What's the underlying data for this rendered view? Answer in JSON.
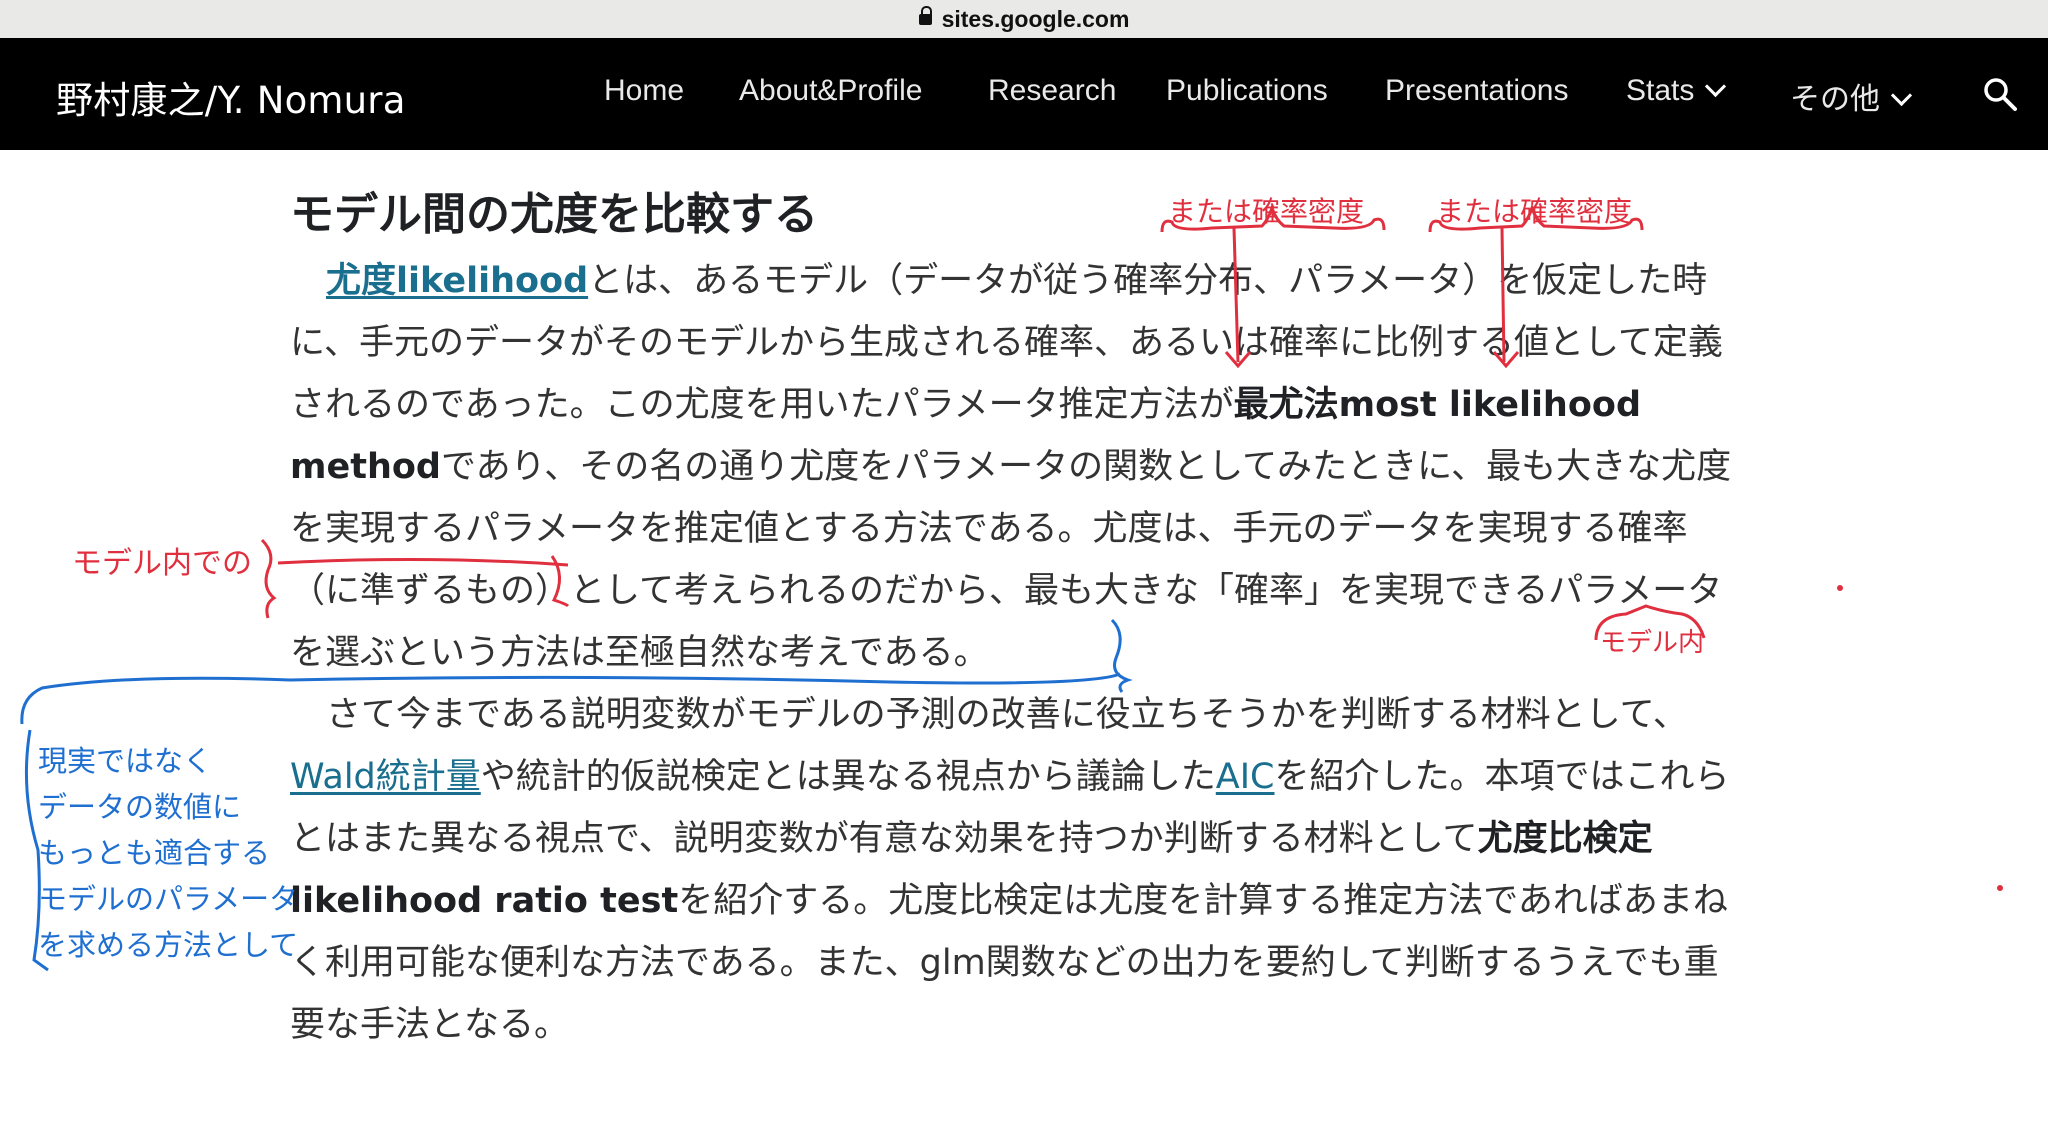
{
  "browser": {
    "url": "sites.google.com"
  },
  "site": {
    "title": "野村康之/Y. Nomura"
  },
  "nav": {
    "items": [
      "Home",
      "About&Profile",
      "Research",
      "Publications",
      "Presentations",
      "Stats",
      "その他"
    ]
  },
  "article": {
    "heading": "モデル間の尤度を比較する",
    "p1": {
      "link_likelihood": "尤度likelihood",
      "t1": "とは、あるモデル（データが従う確率分布、パラメータ）を仮定した時に、手元のデータがそのモデルから生成される確率、あるいは確率に比例する値として定義されるのであった。この尤度を用いたパラメータ推定方法が",
      "b_mle": "最尤法most likelihood method",
      "t2": "であり、その名の通り尤度をパラメータの関数としてみたときに、最も大きな尤度を実現するパラメータを推定値とする方法である。尤度は、手元のデータを実現する確率（に準ずるもの）として考えられるのだから、最も大きな「確率」を実現できるパラメータを選ぶという方法は至極自然な考えである。"
    },
    "p2": {
      "t1": "さて今まである説明変数がモデルの予測の改善に役立ちそうかを判断する材料として、",
      "link_wald": "Wald統計量",
      "t2": "や統計的仮説検定とは異なる視点から議論した",
      "link_aic": "AIC",
      "t3": "を紹介した。本項ではこれらとはまた異なる視点で、説明変数が有意な効果を持つか判断する材料として",
      "b_lrt": "尤度比検定likelihood ratio test",
      "t4": "を紹介する。尤度比検定は尤度を計算する推定方法であればあまねく利用可能な便利な方法である。また、glm関数などの出力を要約して判断するうえでも重要な手法となる。"
    }
  },
  "annotations": {
    "red1": "または確率密度",
    "red2": "または確率密度",
    "red_left": "モデル内での",
    "red_right": "モデル内",
    "blue_note": [
      "現実ではなく",
      "データの数値に",
      "もっとも適合する",
      "モデルのパラメータ",
      "を求める方法として"
    ]
  },
  "colors": {
    "nav_bg": "#000000",
    "link": "#1a6e8e",
    "annotation_red": "#e0303f",
    "annotation_blue": "#1f6fd0"
  }
}
